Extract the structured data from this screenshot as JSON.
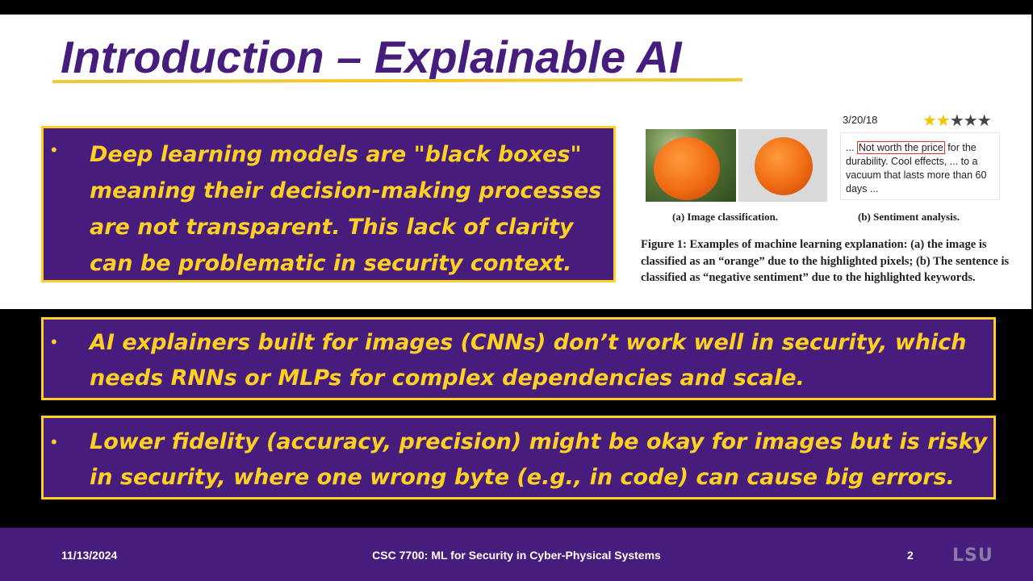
{
  "slide": {
    "title": "Introduction – Explainable AI"
  },
  "bullets": [
    {
      "marker": "•",
      "text": "Deep learning models are \"black boxes\" meaning their decision-making processes are not transparent. This lack of clarity can be problematic in security context."
    },
    {
      "marker": "•",
      "text": "AI explainers built for images (CNNs) don’t work well in security, which needs RNNs or MLPs for complex dependencies and scale."
    },
    {
      "marker": "•",
      "text": "Lower fidelity (accuracy, precision) might be okay for images but is risky in security, where one wrong byte (e.g., in code) can cause big errors."
    }
  ],
  "figure": {
    "review_date": "3/20/18",
    "stars_filled": "★★",
    "stars_empty": "★★★",
    "review_prefix": "...",
    "review_highlight": "Not worth the price",
    "review_rest": " for the durability. Cool effects, ... to a vacuum that lasts more than 60 days ...",
    "caption_a": "(a) Image classification.",
    "caption_b": "(b) Sentiment analysis.",
    "figure_caption": "Figure 1: Examples of machine learning explanation: (a) the image is classified as an “orange” due to the highlighted pixels; (b) The sentence is classified as “negative sentiment” due to the highlighted keywords."
  },
  "footer": {
    "date": "11/13/2024",
    "course": "CSC 7700: ML for Security in Cyber-Physical Systems",
    "page_number": "2",
    "logo": "LSU"
  },
  "colors": {
    "purple": "#461d7c",
    "gold": "#fdd023"
  }
}
